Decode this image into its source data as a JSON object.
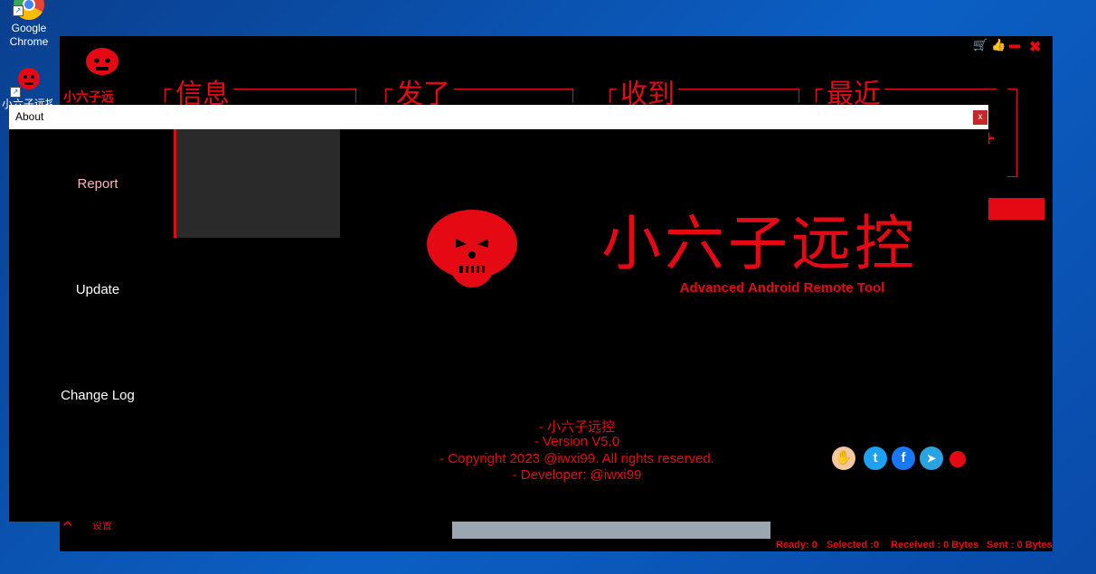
{
  "desktop": {
    "chrome_label": "Google Chrome",
    "app_shortcut_label": "小六子远控"
  },
  "app": {
    "title": "小六子远",
    "tabs": [
      "信息",
      "发了",
      "收到",
      "最近"
    ],
    "window_icons": {
      "cart": "🛒",
      "like": "👍",
      "minimize": "▬",
      "close": "✖"
    },
    "bottom_label": "设置",
    "status": {
      "ready": "Ready: 0",
      "selected": "Selected :0",
      "received": "Received : 0 Bytes",
      "sent": "Sent : 0 Bytes"
    }
  },
  "about": {
    "window_title": "About",
    "close_label": "x",
    "menu": [
      "Report",
      "Update",
      "Change Log"
    ],
    "big_title": "小六子远控",
    "subtitle": "Advanced Android Remote Tool",
    "info": [
      "- 小六子远控",
      "- Version V5.0",
      "- Copyright 2023 @iwxi99. All rights reserved.",
      "- Developer: @iwxi99"
    ],
    "social_glyphs": {
      "twitter": "t",
      "facebook": "f",
      "telegram": "➤"
    }
  },
  "colors": {
    "accent": "#e50914",
    "background": "#000000",
    "panel": "#2a2a2a"
  }
}
